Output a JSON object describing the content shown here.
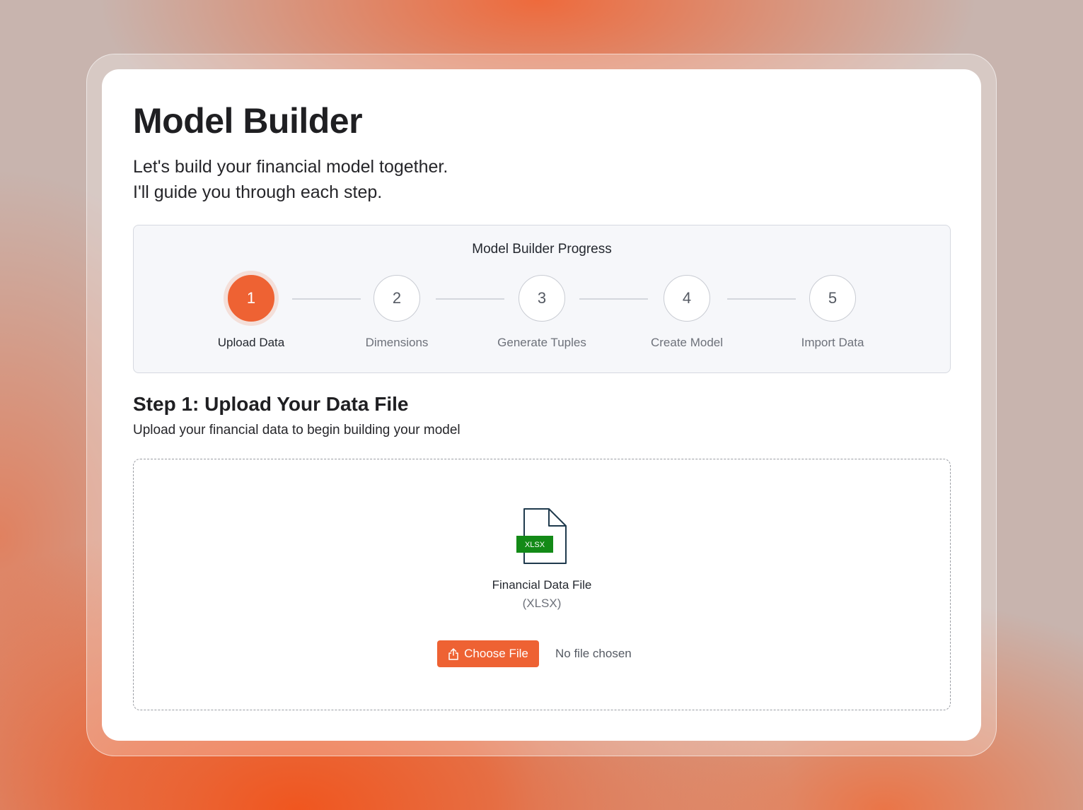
{
  "header": {
    "title": "Model Builder",
    "subtitle_line1": "Let's build your financial model together.",
    "subtitle_line2": "I'll guide you through each step."
  },
  "progress": {
    "title": "Model Builder Progress",
    "current_step": 1,
    "steps": [
      {
        "number": "1",
        "label": "Upload Data"
      },
      {
        "number": "2",
        "label": "Dimensions"
      },
      {
        "number": "3",
        "label": "Generate Tuples"
      },
      {
        "number": "4",
        "label": "Create Model"
      },
      {
        "number": "5",
        "label": "Import Data"
      }
    ]
  },
  "step": {
    "title": "Step 1: Upload Your Data File",
    "description": "Upload your financial data to begin building your model"
  },
  "upload": {
    "file_icon": "xlsx-file-icon",
    "file_badge": "XLSX",
    "file_name": "Financial Data File",
    "file_type": "(XLSX)",
    "button_label": "Choose File",
    "button_icon": "upload-icon",
    "status": "No file chosen"
  },
  "colors": {
    "accent": "#ee6233",
    "xlsx_green": "#138a17",
    "icon_stroke": "#1f3a4d"
  }
}
